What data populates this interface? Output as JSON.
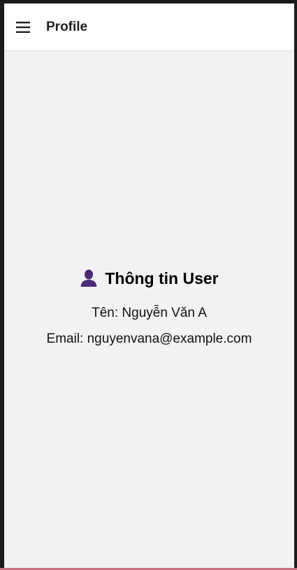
{
  "app_bar": {
    "title": "Profile",
    "menu_icon": "hamburger-menu-icon"
  },
  "profile": {
    "heading": "Thông tin User",
    "heading_icon": "user-icon",
    "name_line": "Tên: Nguyễn Văn A",
    "email_line": "Email: nguyenvana@example.com"
  },
  "colors": {
    "background": "#f2f2f2",
    "app_bar": "#ffffff",
    "icon_purple": "#4b2a78",
    "text": "#111111"
  }
}
